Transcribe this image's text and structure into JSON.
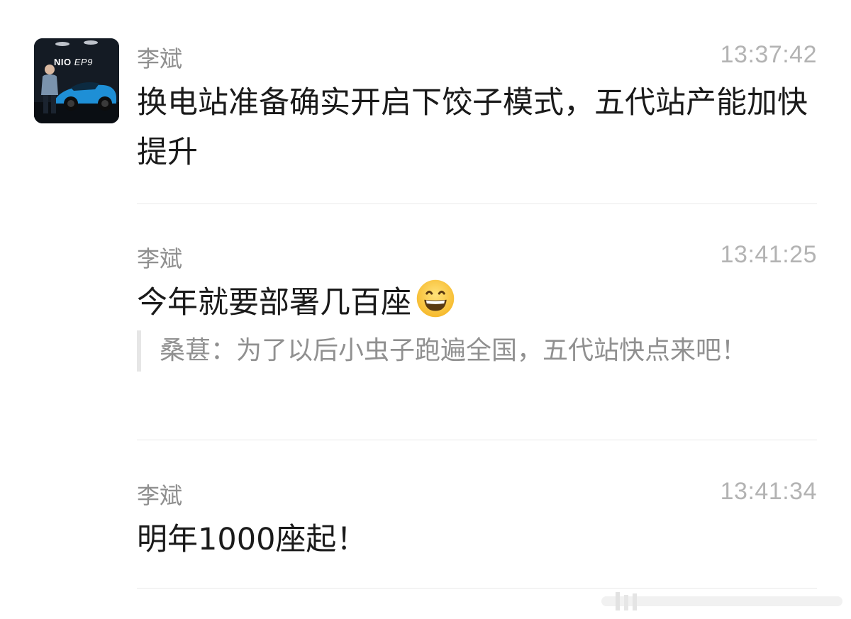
{
  "messages": [
    {
      "sender": "李斌",
      "time": "13:37:42",
      "text": "换电站准备确实开启下饺子模式，五代站产能加快提升"
    },
    {
      "sender": "李斌",
      "time": "13:41:25",
      "text": "今年就要部署几百座",
      "emoji": "grinning-face-emoji",
      "quote": "桑葚：为了以后小虫子跑遍全国，五代站快点来吧！"
    },
    {
      "sender": "李斌",
      "time": "13:41:34",
      "text": "明年1000座起！"
    }
  ],
  "avatar": {
    "logo": "NIO",
    "logo_suffix": "EP9",
    "car_color": "#1e8fd6"
  },
  "colors": {
    "name": "#8f8f8f",
    "time": "#b3b3b3",
    "text": "#1a1a1a",
    "quote_text": "#909090",
    "quote_bar": "#e6e6e6",
    "divider": "#e9e9e9"
  }
}
